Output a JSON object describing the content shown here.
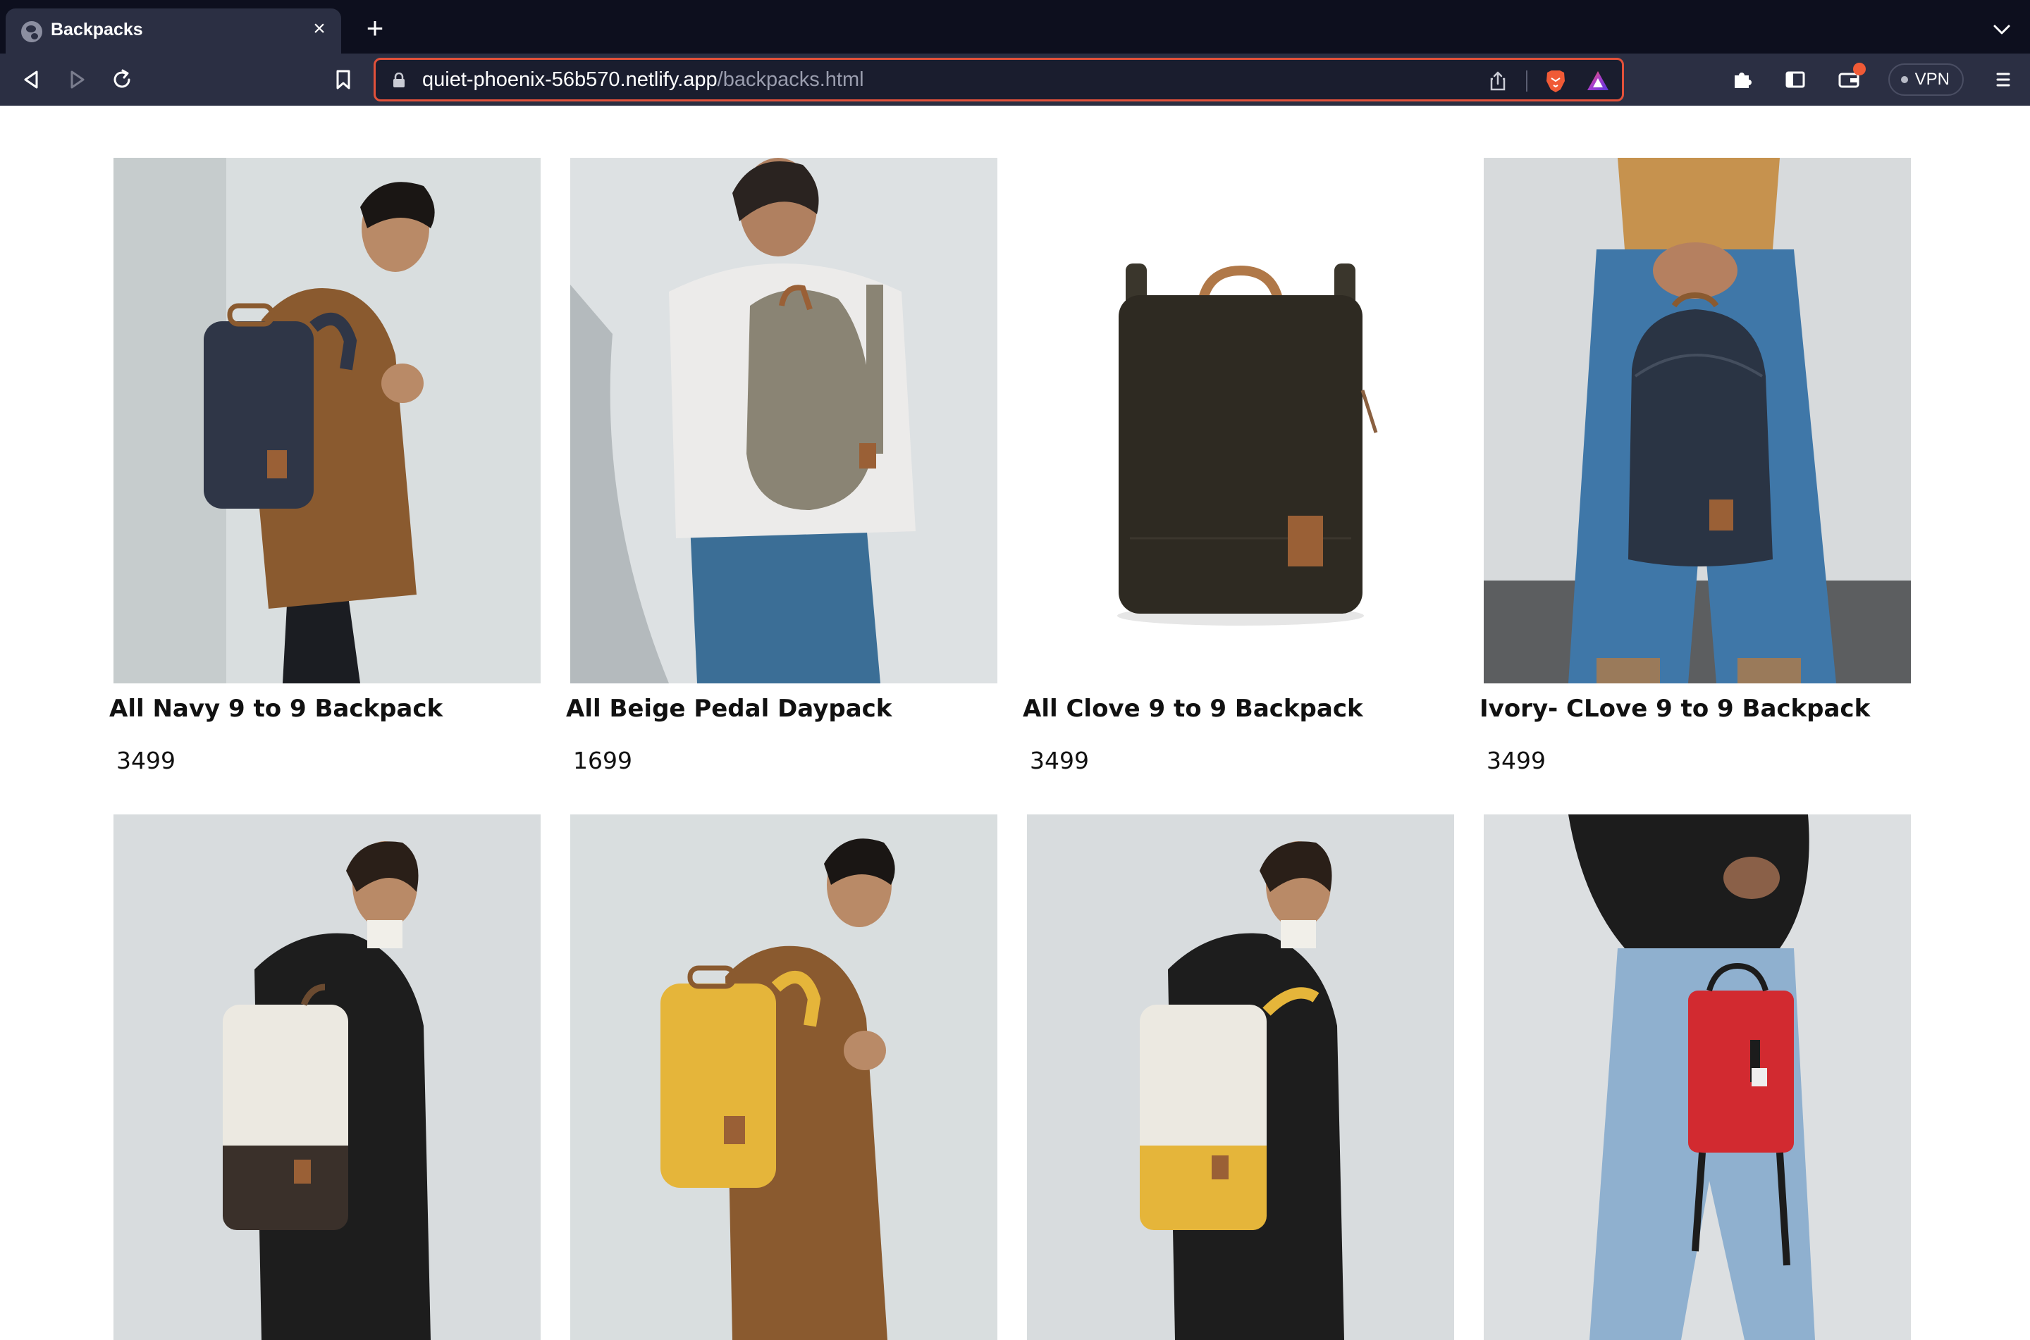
{
  "browser": {
    "tab_title": "Backpacks",
    "url_domain": "quiet-phoenix-56b570.netlify.app",
    "url_path": "/backpacks.html",
    "vpn_label": "VPN"
  },
  "icons": {
    "favicon": "globe-icon",
    "back": "back-arrow-icon",
    "forward": "forward-arrow-icon",
    "reload": "reload-icon",
    "bookmark": "bookmark-icon",
    "lock": "lock-icon",
    "share": "share-icon",
    "brave_shields": "brave-lion-icon",
    "rewards": "triangle-rewards-icon",
    "extensions": "puzzle-icon",
    "sidebar": "sidebar-icon",
    "wallet": "wallet-icon",
    "menu": "hamburger-menu-icon"
  },
  "colors": {
    "tabbar_bg": "#0d0f1e",
    "toolbar_bg": "#2b2f43",
    "urlbar_border": "#e2513a",
    "page_bg": "#ffffff"
  },
  "products": [
    {
      "name": "All Navy 9 to 9 Backpack",
      "price": "3499",
      "bag_color": "#2f3647",
      "model": "man-brown-jacket"
    },
    {
      "name": "All Beige Pedal Daypack",
      "price": "1699",
      "bag_color": "#8a8474",
      "model": "man-white-sweater"
    },
    {
      "name": "All Clove 9 to 9 Backpack",
      "price": "3499",
      "bag_color": "#2e2a22",
      "model": "product-only"
    },
    {
      "name": "Ivory- CLove 9 to 9 Backpack",
      "price": "3499",
      "bag_color": "#2a3444",
      "model": "man-jeans"
    },
    {
      "name": "",
      "price": "",
      "bag_color": "#ece9e1",
      "model": "woman-black-jacket"
    },
    {
      "name": "",
      "price": "",
      "bag_color": "#e5b53a",
      "model": "man-brown-jacket"
    },
    {
      "name": "",
      "price": "",
      "bag_color": "#ece9e1",
      "model": "woman-black-jacket"
    },
    {
      "name": "",
      "price": "",
      "bag_color": "#d22a30",
      "model": "person-jeans"
    }
  ]
}
